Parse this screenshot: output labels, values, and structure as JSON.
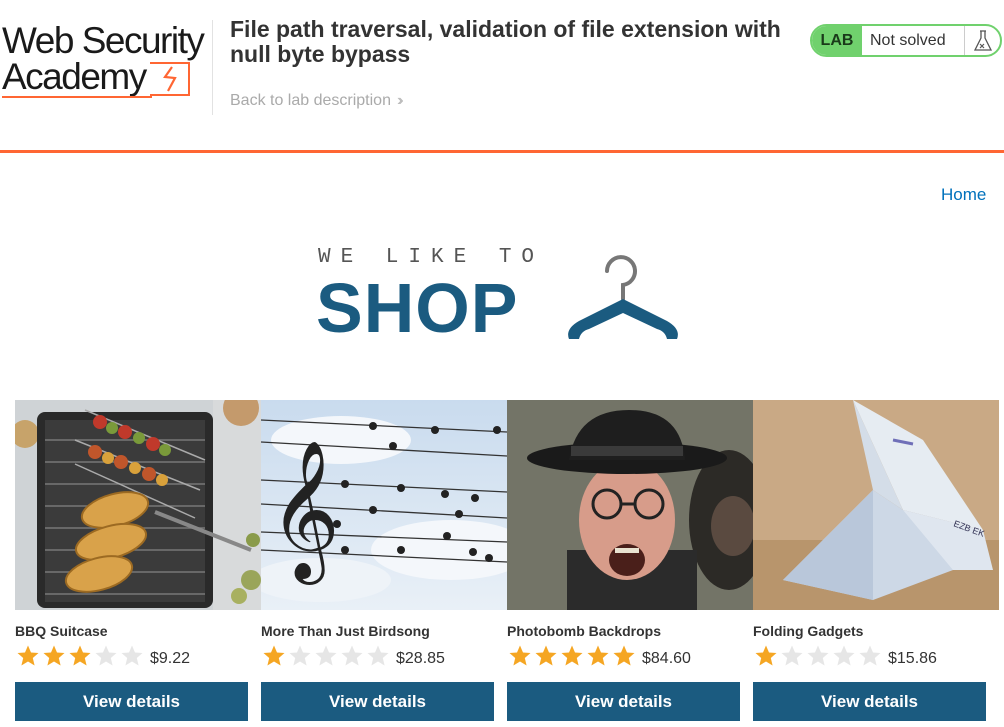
{
  "header": {
    "logo_line1": "Web Security",
    "logo_line2": "Academy",
    "lab_title": "File path traversal, validation of file extension with null byte bypass",
    "back_link": "Back to lab description",
    "lab_badge": "LAB",
    "lab_status": "Not solved"
  },
  "nav": {
    "home": "Home"
  },
  "banner": {
    "tagline": "WE LIKE TO",
    "headline": "SHOP"
  },
  "colors": {
    "accent_orange": "#ff6633",
    "brand_blue": "#1b5b80",
    "status_green": "#70d16d",
    "link_blue": "#0071bc",
    "star_gold": "#f5a623",
    "star_empty": "#e6e6e6"
  },
  "products": [
    {
      "name": "BBQ Suitcase",
      "rating": 3,
      "price": "$9.22",
      "button": "View details",
      "image_icon": "bbq-grill-image"
    },
    {
      "name": "More Than Just Birdsong",
      "rating": 1,
      "price": "$28.85",
      "button": "View details",
      "image_icon": "birds-on-wires-image"
    },
    {
      "name": "Photobomb Backdrops",
      "rating": 5,
      "price": "$84.60",
      "button": "View details",
      "image_icon": "photobomb-portrait-image"
    },
    {
      "name": "Folding Gadgets",
      "rating": 1,
      "price": "$15.86",
      "button": "View details",
      "image_icon": "origami-bird-image"
    }
  ]
}
